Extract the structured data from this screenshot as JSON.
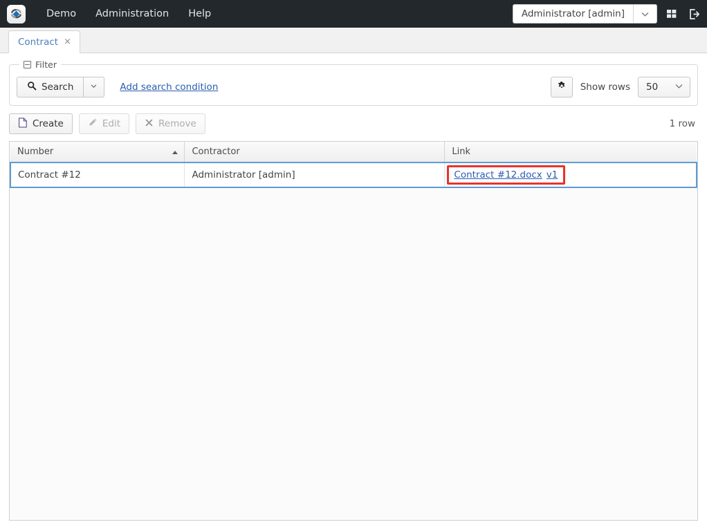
{
  "navbar": {
    "logo_icon": "app-logo-icon",
    "links": [
      {
        "label": "Demo"
      },
      {
        "label": "Administration"
      },
      {
        "label": "Help"
      }
    ],
    "user_selector": {
      "value": "Administrator [admin]",
      "caret_icon": "chevron-down-icon"
    },
    "apps_icon": "grid-apps-icon",
    "logout_icon": "logout-icon"
  },
  "tabs": [
    {
      "label": "Contract",
      "close_label": "×",
      "active": true
    }
  ],
  "filter": {
    "legend": "Filter",
    "collapse_icon": "collapse-minus-icon",
    "search_button": {
      "label": "Search",
      "icon": "search-icon",
      "caret_icon": "chevron-down-icon"
    },
    "add_condition_link": "Add search condition",
    "settings_icon": "gear-icon",
    "show_rows_label": "Show rows",
    "show_rows_value": "50",
    "show_rows_caret": "chevron-down-icon"
  },
  "toolbar": {
    "create_label": "Create",
    "create_icon": "new-document-icon",
    "edit_label": "Edit",
    "edit_icon": "pencil-icon",
    "remove_label": "Remove",
    "remove_icon": "cross-icon",
    "row_count": "1 row"
  },
  "grid": {
    "columns": [
      {
        "label": "Number",
        "sort": "asc",
        "width": "25.4%"
      },
      {
        "label": "Contractor",
        "sort": "none",
        "width": "37.9%"
      },
      {
        "label": "Link",
        "sort": "none",
        "width": "36.7%"
      }
    ],
    "rows": [
      {
        "selected": true,
        "number": "Contract #12",
        "contractor": "Administrator [admin]",
        "link_file": "Contract #12.docx",
        "link_version": "v1",
        "link_highlighted": true
      }
    ]
  },
  "colors": {
    "navbar_bg": "#23282d",
    "link": "#2a5db0",
    "tab_label": "#4a7ebb",
    "selection_border": "#5b9bd5",
    "highlight_border": "#e8322a"
  }
}
